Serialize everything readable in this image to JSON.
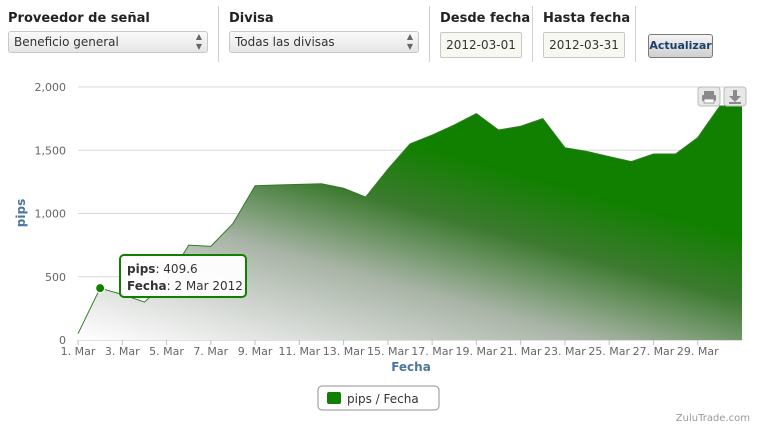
{
  "filters": {
    "provider": {
      "label": "Proveedor de señal",
      "value": "Beneficio general"
    },
    "currency": {
      "label": "Divisa",
      "value": "Todas las divisas"
    },
    "from": {
      "label": "Desde fecha",
      "value": "2012-03-01"
    },
    "to": {
      "label": "Hasta fecha",
      "value": "2012-03-31"
    },
    "update_label": "Actualizar"
  },
  "icons": [
    "print-icon",
    "download-icon"
  ],
  "chart_data": {
    "type": "area",
    "xlabel": "Fecha",
    "ylabel": "pips",
    "ylim": [
      0,
      2000
    ],
    "yticks": [
      "0",
      "500",
      "1,000",
      "1,500",
      "2,000"
    ],
    "xticks": [
      "1. Mar",
      "3. Mar",
      "5. Mar",
      "7. Mar",
      "9. Mar",
      "11. Mar",
      "13. Mar",
      "15. Mar",
      "17. Mar",
      "19. Mar",
      "21. Mar",
      "23. Mar",
      "25. Mar",
      "27. Mar",
      "29. Mar"
    ],
    "x": [
      1,
      2,
      3,
      4,
      5,
      6,
      7,
      8,
      9,
      10,
      11,
      12,
      13,
      14,
      15,
      16,
      17,
      18,
      19,
      20,
      21,
      22,
      23,
      24,
      25,
      26,
      27,
      28,
      29,
      30,
      31
    ],
    "series": [
      {
        "name": "pips",
        "values": [
          50,
          409.6,
          360,
          300,
          460,
          750,
          740,
          920,
          1220,
          1225,
          1230,
          1235,
          1200,
          1130,
          1350,
          1550,
          1620,
          1700,
          1790,
          1660,
          1690,
          1750,
          1520,
          1490,
          1450,
          1410,
          1470,
          1470,
          1600,
          1850,
          1850
        ]
      }
    ],
    "legend": {
      "position": "bottom-center",
      "text": "pips / Fecha"
    },
    "tooltip": {
      "series_label": "pips",
      "value": "409.6",
      "date_label": "Fecha",
      "date": "2 Mar 2012",
      "point_index": 1
    },
    "colors": {
      "series": "#118000",
      "axis_title": "#4d759e",
      "tick": "#666666",
      "grid": "#d8d8d8"
    },
    "grid": true
  },
  "watermark": "ZuluTrade.com"
}
